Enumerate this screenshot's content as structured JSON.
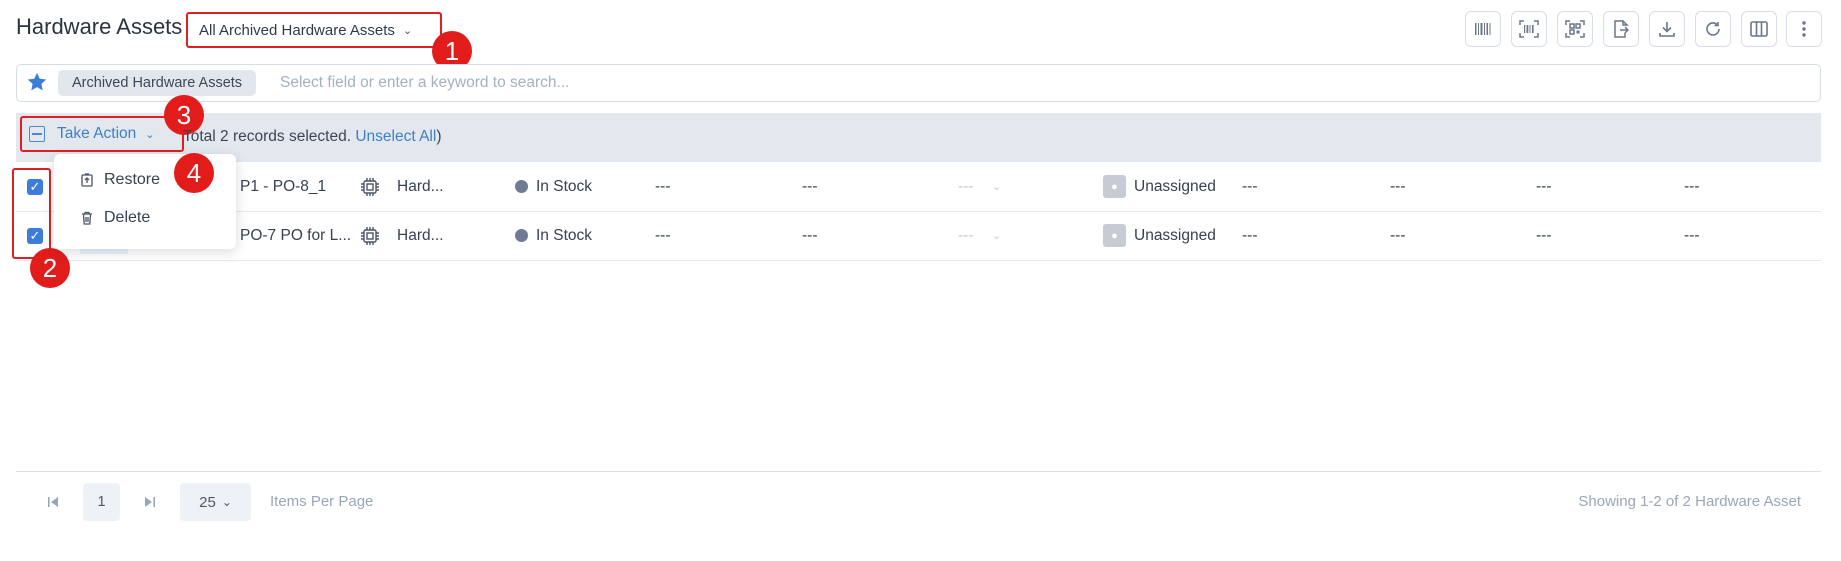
{
  "header": {
    "title": "Hardware Assets",
    "view_selector": "All Archived Hardware Assets"
  },
  "toolbar": {
    "icons": [
      "barcode-icon",
      "scan-barcode-icon",
      "qr-scan-icon",
      "export-icon",
      "download-icon",
      "refresh-icon",
      "columns-icon",
      "more-vertical-icon"
    ]
  },
  "search": {
    "saved_filter": "Archived Hardware Assets",
    "placeholder": "Select field or enter a keyword to search..."
  },
  "action_bar": {
    "take_action_label": "Take Action",
    "selection_text": "Total 2 records selected.",
    "unselect_label": "Unselect All",
    "close_paren": ")"
  },
  "menu": {
    "items": [
      {
        "label": "Restore",
        "icon": "restore-icon"
      },
      {
        "label": "Delete",
        "icon": "trash-icon"
      }
    ]
  },
  "rows": [
    {
      "checked": true,
      "name": "P1 - PO-8_1",
      "type": "Hard...",
      "status": "In Stock",
      "c1": "---",
      "c2": "---",
      "c3": "---",
      "assignee": "Unassigned",
      "c4": "---",
      "c5": "---",
      "c6": "---",
      "c7": "---"
    },
    {
      "checked": true,
      "name": "PO-7 PO for L...",
      "type": "Hard...",
      "status": "In Stock",
      "c1": "---",
      "c2": "---",
      "c3": "---",
      "assignee": "Unassigned",
      "c4": "---",
      "c5": "---",
      "c6": "---",
      "c7": "---"
    }
  ],
  "annotations": [
    "1",
    "2",
    "3",
    "4"
  ],
  "pagination": {
    "current_page": "1",
    "page_size": "25",
    "items_per_page_label": "Items Per Page",
    "summary": "Showing 1-2 of 2 Hardware Asset"
  },
  "colors": {
    "accent": "#3e7fc4",
    "annotation": "#e21b1b",
    "status_in_stock": "#6f7d92",
    "action_bar_bg": "#e3e8ef"
  }
}
